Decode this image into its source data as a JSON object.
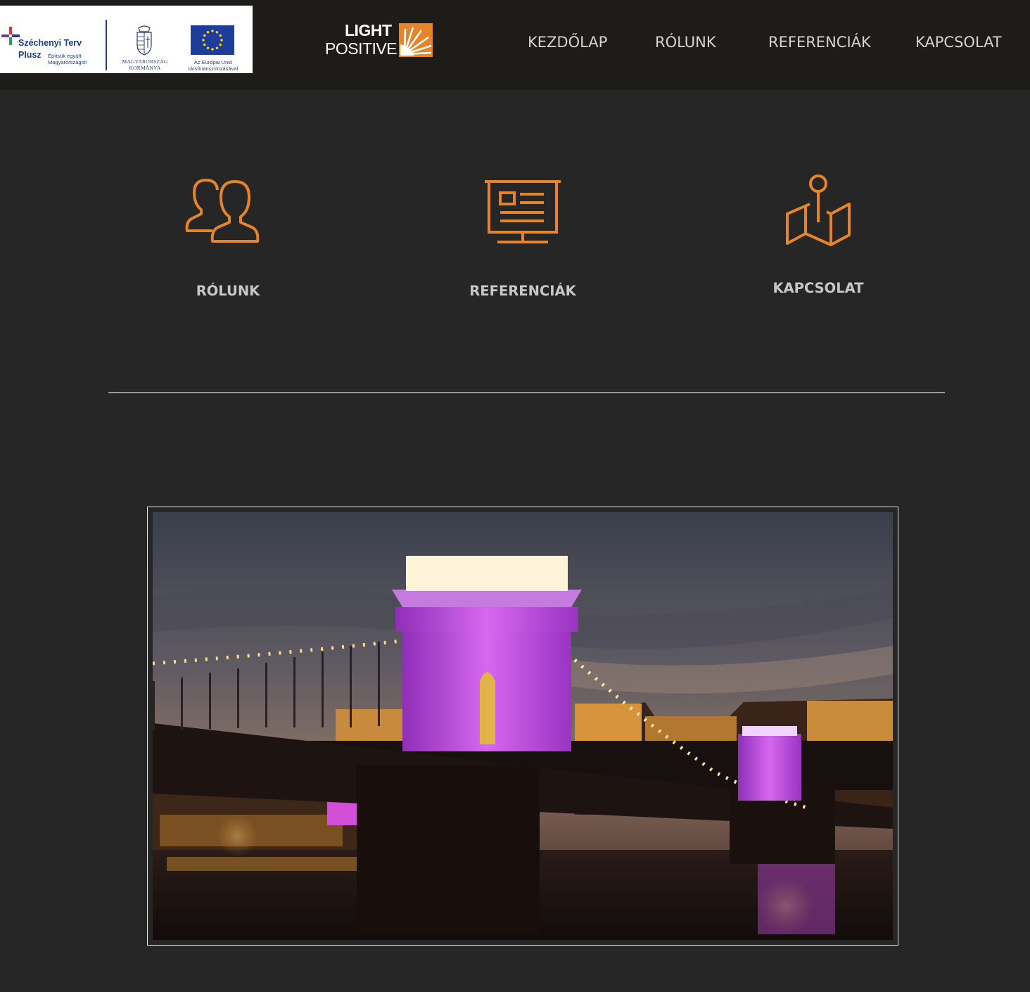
{
  "header": {
    "partners": {
      "szechenyi_title": "Széchenyi Terv",
      "szechenyi_plus": "Plusz",
      "szechenyi_slogan": "Építsük együtt Magyarországot!",
      "government_line1": "MAGYARORSZÁG",
      "government_line2": "KORMÁNYA",
      "eu_line1": "Az Európai Unió",
      "eu_line2": "társfinanszírozásával"
    },
    "brand": {
      "light": "LIGHT",
      "positive": "POSITIVE",
      "accent_color": "#e6842a"
    },
    "nav": {
      "home": "KEZDŐLAP",
      "about": "RÓLUNK",
      "references": "REFERENCIÁK",
      "contact": "KAPCSOLAT"
    }
  },
  "features": [
    {
      "label": "RÓLUNK",
      "icon": "users-icon"
    },
    {
      "label": "REFERENCIÁK",
      "icon": "presentation-board-icon"
    },
    {
      "label": "KAPCSOLAT",
      "icon": "map-pin-icon"
    }
  ],
  "photo": {
    "subject": "chain-bridge-night-photo"
  },
  "colors": {
    "background": "#262626",
    "header_background": "#1d1c19",
    "icon_orange": "#e6842a",
    "nav_text": "#d4d4d4"
  }
}
